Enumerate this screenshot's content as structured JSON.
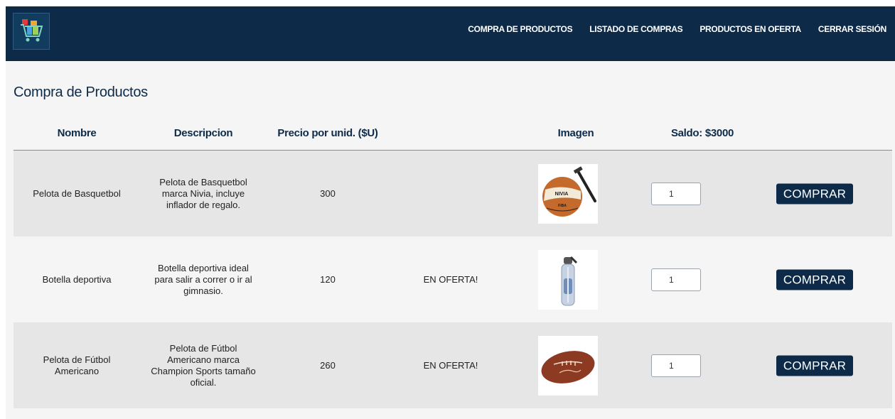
{
  "nav": {
    "links": [
      "COMPRA DE PRODUCTOS",
      "LISTADO DE COMPRAS",
      "PRODUCTOS EN OFERTA",
      "CERRAR SESIÓN"
    ]
  },
  "page_title": "Compra de Productos",
  "table": {
    "headers": {
      "nombre": "Nombre",
      "descripcion": "Descripcion",
      "precio": "Precio por unid. ($U)",
      "imagen": "Imagen",
      "saldo": "Saldo: $3000"
    },
    "rows": [
      {
        "nombre": "Pelota de Basquetbol",
        "descripcion": "Pelota de Basquetbol marca Nivia, incluye inflador de regalo.",
        "precio": "300",
        "oferta": "",
        "image_icon": "basketball-with-pump-icon",
        "cantidad": "1",
        "boton": "COMPRAR"
      },
      {
        "nombre": "Botella deportiva",
        "descripcion": "Botella deportiva ideal para salir a correr o ir al gimnasio.",
        "precio": "120",
        "oferta": "EN OFERTA!",
        "image_icon": "water-bottle-icon",
        "cantidad": "1",
        "boton": "COMPRAR"
      },
      {
        "nombre": "Pelota de Fútbol Americano",
        "descripcion": "Pelota de Fútbol Americano marca Champion Sports tamaño oficial.",
        "precio": "260",
        "oferta": "EN OFERTA!",
        "image_icon": "american-football-icon",
        "cantidad": "1",
        "boton": "COMPRAR"
      }
    ]
  },
  "colors": {
    "navbar": "#0d2b48",
    "button": "#0d2b48",
    "row_shaded": "#e6e6e6"
  }
}
